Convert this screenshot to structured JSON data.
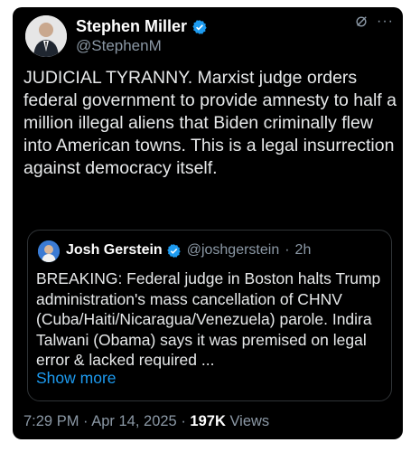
{
  "colors": {
    "background": "#000000",
    "text": "#e7e9ea",
    "secondary": "#8b98a5",
    "accent": "#1d9bf0",
    "border": "#2f3336"
  },
  "author": {
    "name": "Stephen Miller",
    "handle": "@StephenM",
    "avatar_icon": "person-avatar-icon",
    "verified_icon": "verified-badge-icon"
  },
  "header_icons": [
    "grok-icon",
    "more-icon"
  ],
  "more_icon_glyph": "···",
  "tweet": {
    "text": "JUDICIAL TYRANNY. Marxist judge orders federal government to provide amnesty to half a million illegal aliens that Biden criminally flew into American towns. This is a legal insurrection against democracy itself."
  },
  "quoted_tweet": {
    "name": "Josh Gerstein",
    "handle": "@joshgerstein",
    "separator": "·",
    "time": "2h",
    "text": "BREAKING: Federal judge in Boston halts Trump administration's mass cancellation of CHNV (Cuba/Haiti/Nicaragua/Venezuela) parole. Indira Talwani (Obama) says it was premised on legal error & lacked required ...",
    "show_more": "Show more"
  },
  "footer": {
    "time": "7:29 PM",
    "separator": "·",
    "date": "Apr 14, 2025",
    "views_count": "197K",
    "views_label": "Views"
  }
}
